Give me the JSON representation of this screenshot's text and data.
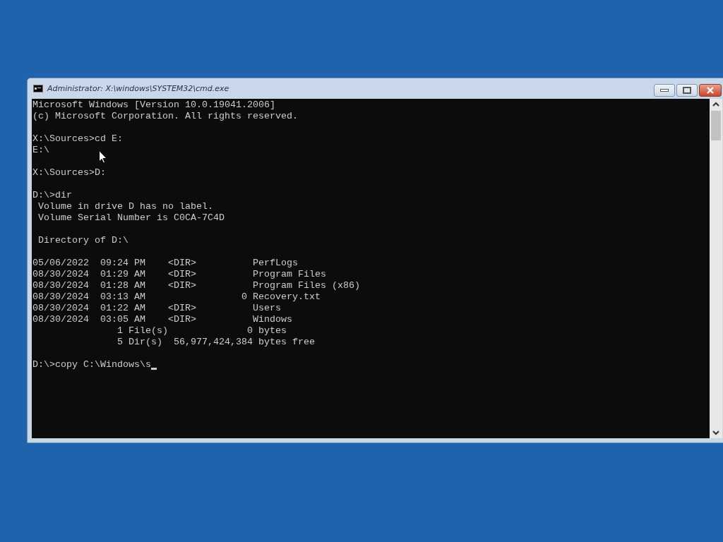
{
  "window": {
    "title": "Administrator: X:\\windows\\SYSTEM32\\cmd.exe"
  },
  "console": {
    "blocks": [
      [
        "Microsoft Windows [Version 10.0.19041.2006]",
        "(c) Microsoft Corporation. All rights reserved."
      ],
      [
        "X:\\Sources>cd E:",
        "E:\\"
      ],
      [
        "X:\\Sources>D:"
      ],
      [
        "D:\\>dir",
        " Volume in drive D has no label.",
        " Volume Serial Number is C0CA-7C4D"
      ],
      [
        " Directory of D:\\"
      ],
      [
        "05/06/2022  09:24 PM    <DIR>          PerfLogs",
        "08/30/2024  01:29 AM    <DIR>          Program Files",
        "08/30/2024  01:28 AM    <DIR>          Program Files (x86)",
        "08/30/2024  03:13 AM                 0 Recovery.txt",
        "08/30/2024  01:22 AM    <DIR>          Users",
        "08/30/2024  03:05 AM    <DIR>          Windows",
        "               1 File(s)              0 bytes",
        "               5 Dir(s)  56,977,424,384 bytes free"
      ]
    ],
    "input_line": {
      "text": "D:\\>copy C:\\Windows\\s",
      "cursor": true
    }
  }
}
